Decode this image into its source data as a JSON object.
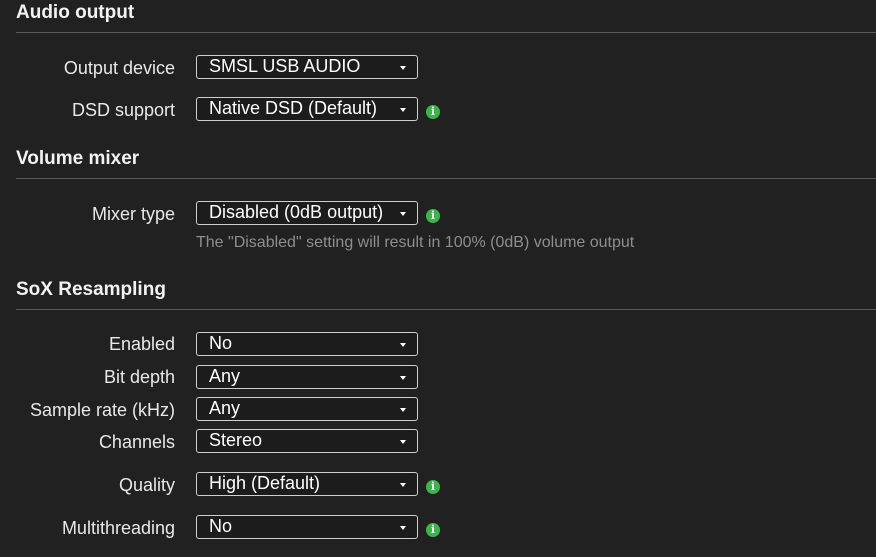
{
  "audio_output": {
    "title": "Audio output",
    "output_device": {
      "label": "Output device",
      "value": "SMSL USB AUDIO"
    },
    "dsd_support": {
      "label": "DSD support",
      "value": "Native DSD (Default)"
    }
  },
  "volume_mixer": {
    "title": "Volume mixer",
    "mixer_type": {
      "label": "Mixer type",
      "value": "Disabled (0dB output)",
      "help": "The \"Disabled\" setting will result in 100% (0dB) volume output"
    }
  },
  "sox_resampling": {
    "title": "SoX Resampling",
    "enabled": {
      "label": "Enabled",
      "value": "No"
    },
    "bit_depth": {
      "label": "Bit depth",
      "value": "Any"
    },
    "sample_rate": {
      "label": "Sample rate (kHz)",
      "value": "Any"
    },
    "channels": {
      "label": "Channels",
      "value": "Stereo"
    },
    "quality": {
      "label": "Quality",
      "value": "High (Default)"
    },
    "multithreading": {
      "label": "Multithreading",
      "value": "No"
    }
  },
  "icons": {
    "info": "info-circle-icon",
    "caret": "caret-down-icon"
  },
  "colors": {
    "background": "#212121",
    "info_icon": "#3bb54a",
    "help_text": "#8e8e8e"
  }
}
